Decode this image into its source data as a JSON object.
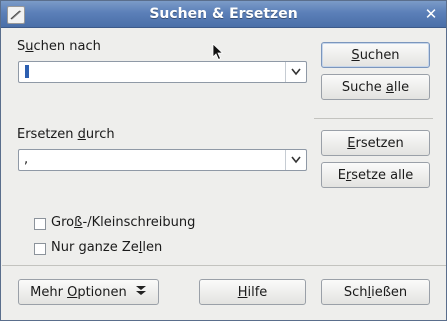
{
  "window": {
    "title": "Suchen & Ersetzen",
    "close_symbol": "✕"
  },
  "search": {
    "label_pre": "S",
    "label_ul": "u",
    "label_post": "chen nach",
    "value": ""
  },
  "replace": {
    "label_pre": "Ersetzen ",
    "label_ul": "d",
    "label_post": "urch",
    "value": ","
  },
  "buttons": {
    "search_pre": "",
    "search_ul": "S",
    "search_post": "uchen",
    "search_all_pre": "Suche ",
    "search_all_ul": "a",
    "search_all_post": "lle",
    "replace_pre": "",
    "replace_ul": "E",
    "replace_post": "rsetzen",
    "replace_all_pre": "E",
    "replace_all_ul": "r",
    "replace_all_post": "setze alle",
    "more_pre": "Mehr ",
    "more_ul": "O",
    "more_post": "ptionen",
    "help_pre": "",
    "help_ul": "H",
    "help_post": "ilfe",
    "close_pre": "Sch",
    "close_ul": "l",
    "close_post": "ießen"
  },
  "options": {
    "match_case_pre": "Gro",
    "match_case_ul": "ß",
    "match_case_post": "-/Kleinschreibung",
    "match_case_checked": false,
    "whole_cells_pre": "Nur ganze Ze",
    "whole_cells_ul": "l",
    "whole_cells_post": "len",
    "whole_cells_checked": false
  }
}
